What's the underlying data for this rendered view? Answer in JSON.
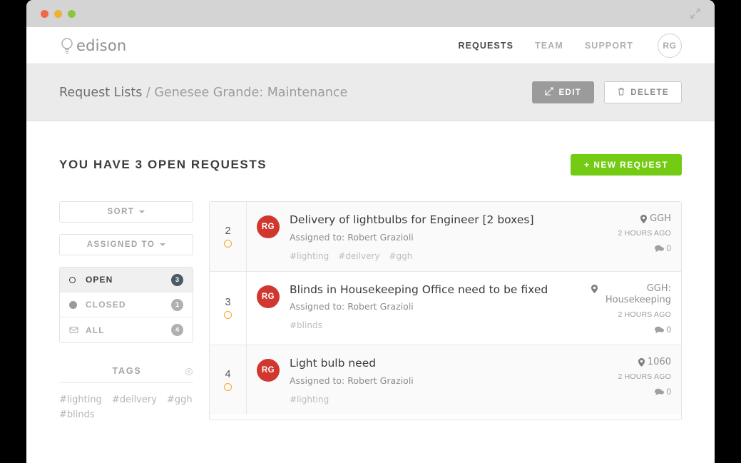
{
  "window": {
    "traffic_lights": [
      "close",
      "minimize",
      "maximize"
    ],
    "expand_icon": "expand-arrows-icon"
  },
  "header": {
    "logo_icon": "lightbulb-icon",
    "logo_text": "edison",
    "nav": [
      {
        "label": "REQUESTS",
        "active": true
      },
      {
        "label": "TEAM",
        "active": false
      },
      {
        "label": "SUPPORT",
        "active": false
      }
    ],
    "avatar": "RG"
  },
  "subbar": {
    "breadcrumb_first": "Request Lists",
    "breadcrumb_sep": " / ",
    "breadcrumb_last": "Genesee Grande: Maintenance",
    "edit_label": "EDIT",
    "edit_icon": "pencil-square-icon",
    "delete_label": "DELETE",
    "delete_icon": "trash-icon"
  },
  "main": {
    "page_title": "YOU HAVE 3 OPEN REQUESTS",
    "new_request_label": "+ NEW REQUEST",
    "accent_green": "#73cb14"
  },
  "sidebar": {
    "sort_label": "SORT",
    "assigned_to_label": "ASSIGNED TO",
    "filters": [
      {
        "label": "OPEN",
        "count": "3",
        "icon": "open-circle-icon",
        "active": true
      },
      {
        "label": "CLOSED",
        "count": "1",
        "icon": "filled-circle-icon",
        "active": false
      },
      {
        "label": "ALL",
        "count": "4",
        "icon": "inbox-icon",
        "active": false
      }
    ],
    "tags_title": "TAGS",
    "tags_settings_icon": "gear-icon",
    "tags": [
      "#lighting",
      "#deilvery",
      "#ggh",
      "#blinds"
    ]
  },
  "requests": [
    {
      "number": "2",
      "status_icon": "open-ring-icon",
      "avatar": "RG",
      "title": "Delivery of lightbulbs for Engineer [2 boxes]",
      "assigned": "Assigned to: Robert Grazioli",
      "tags": [
        "#lighting",
        "#deilvery",
        "#ggh"
      ],
      "location": "GGH",
      "location_icon": "map-pin-icon",
      "time": "2 HOURS AGO",
      "comments": "0",
      "comments_icon": "comment-bubble-icon",
      "shaded": true
    },
    {
      "number": "3",
      "status_icon": "open-ring-icon",
      "avatar": "RG",
      "title": "Blinds in Housekeeping Office need to be fixed",
      "assigned": "Assigned to: Robert Grazioli",
      "tags": [
        "#blinds"
      ],
      "location": "GGH: Housekeeping",
      "location_icon": "map-pin-icon",
      "time": "2 HOURS AGO",
      "comments": "0",
      "comments_icon": "comment-bubble-icon",
      "shaded": false
    },
    {
      "number": "4",
      "status_icon": "open-ring-icon",
      "avatar": "RG",
      "title": "Light bulb need",
      "assigned": "Assigned to: Robert Grazioli",
      "tags": [
        "#lighting"
      ],
      "location": "1060",
      "location_icon": "map-pin-icon",
      "time": "2 HOURS AGO",
      "comments": "0",
      "comments_icon": "comment-bubble-icon",
      "shaded": true
    }
  ]
}
